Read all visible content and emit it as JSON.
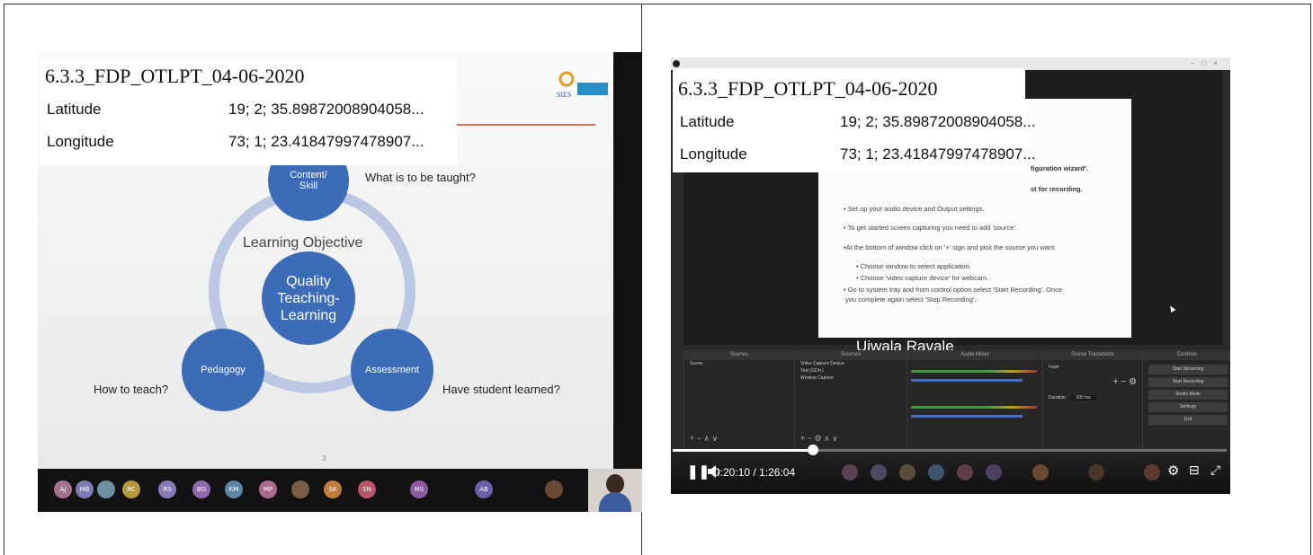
{
  "overlay": {
    "title": "6.3.3_FDP_OTLPT_04-06-2020",
    "latitude_label": "Latitude",
    "latitude_value": "19; 2; 35.89872008904058...",
    "longitude_label": "Longitude",
    "longitude_value": "73; 1; 23.41847997478907..."
  },
  "slide": {
    "nodes": {
      "content": "Content/ Skill",
      "quality": "Quality Teaching-Learning",
      "pedagogy": "Pedagogy",
      "assessment": "Assessment"
    },
    "learning_objective": "Learning Objective",
    "q_taught": "What is to be taught?",
    "q_how": "How to teach?",
    "q_learned": "Have student learned?",
    "page_number": "3"
  },
  "participants_left": [
    "AJ",
    "MB",
    "",
    "RC",
    "RS",
    "BG",
    "KM",
    "MP",
    "",
    "SK",
    "SN",
    "MS",
    "AB"
  ],
  "inner_slide": {
    "line1": "figuration wizard'.",
    "line2": "st for recording.",
    "b1": "• Set up your audio device and Output settings.",
    "b2": "• To get started screen capturing you need to add 'source'.",
    "b3": "•At the bottom of window click on '+' sign and pick the source you want.",
    "b4": "• Choose window to select application.",
    "b5": "• Choose 'video capture device' for webcam.",
    "b6": "• Go to system tray and from control option select 'Start Recording'. Once",
    "b7": "you complete again select 'Stop Recording'."
  },
  "presenter_name": "Ujwala Ravale",
  "obs": {
    "docks": [
      "Scenes",
      "Sources",
      "Audio Mixer",
      "Scene Transitions",
      "Controls"
    ],
    "scene": "Scene",
    "sources": [
      "Video Capture Device",
      "Text (GDI+)",
      "Window Capture"
    ],
    "transition": "Fade",
    "duration_label": "Duration",
    "duration_value": "300 ms",
    "controls": [
      "Start Streaming",
      "Start Recording",
      "Studio Mode",
      "Settings",
      "Exit"
    ]
  },
  "player": {
    "current_time": "0:20:10",
    "separator": "/",
    "total_time": "1:26:04",
    "progress_fraction": 0.254
  },
  "colors": {
    "node_blue": "#3c6cb8",
    "ring": "#bcc7e3",
    "accent_line": "#d9735a"
  }
}
